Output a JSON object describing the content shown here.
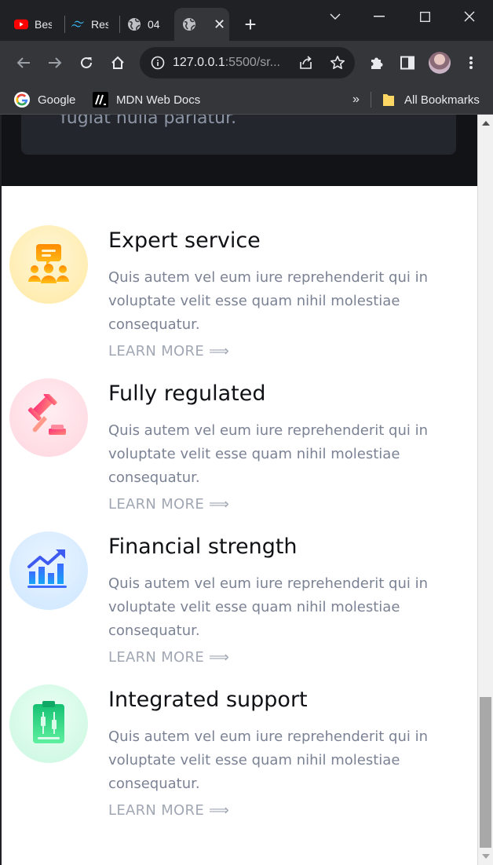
{
  "browser": {
    "tabs": [
      {
        "title": "Bes",
        "icon": "youtube-icon",
        "active": false
      },
      {
        "title": "Res",
        "icon": "tailwind-icon",
        "active": false
      },
      {
        "title": "04",
        "icon": "globe-icon",
        "active": false
      },
      {
        "title": "",
        "icon": "globe-icon",
        "active": true
      }
    ],
    "url_host": "127.0.0.1",
    "url_rest": ":5500/sr...",
    "bookmarks": [
      {
        "label": "Google",
        "icon": "google-icon"
      },
      {
        "label": "MDN Web Docs",
        "icon": "mdn-icon"
      }
    ],
    "overflow_label": "»",
    "all_bookmarks_label": "All Bookmarks"
  },
  "page": {
    "top_card_text": "fugiat nulla pariatur.",
    "features": [
      {
        "title": "Expert service",
        "description": "Quis autem vel eum iure reprehenderit qui in voluptate velit esse quam nihil molestiae consequatur.",
        "link": "LEARN MORE ⟹",
        "icon": "customer-support-icon",
        "bubble": [
          "#ffe9a3",
          "#fff6d6"
        ]
      },
      {
        "title": "Fully regulated",
        "description": "Quis autem vel eum iure reprehenderit qui in voluptate velit esse quam nihil molestiae consequatur.",
        "link": "LEARN MORE ⟹",
        "icon": "gavel-icon",
        "bubble": [
          "#ffd5de",
          "#ffeef2"
        ]
      },
      {
        "title": "Financial strength",
        "description": "Quis autem vel eum iure reprehenderit qui in voluptate velit esse quam nihil molestiae consequatur.",
        "link": "LEARN MORE ⟹",
        "icon": "growth-chart-icon",
        "bubble": [
          "#cde6ff",
          "#eaf5ff"
        ]
      },
      {
        "title": "Integrated support",
        "description": "Quis autem vel eum iure reprehenderit qui in voluptate velit esse quam nihil molestiae consequatur.",
        "link": "LEARN MORE ⟹",
        "icon": "clipboard-chart-icon",
        "bubble": [
          "#c8f7df",
          "#ecfff5"
        ]
      }
    ]
  },
  "colors": {
    "chrome_bg": "#202124",
    "toolbar_bg": "#35363a",
    "page_bg": "#ffffff",
    "heading": "#0f1115",
    "body_text": "#7b8294",
    "link_text": "#a1a7b3"
  }
}
